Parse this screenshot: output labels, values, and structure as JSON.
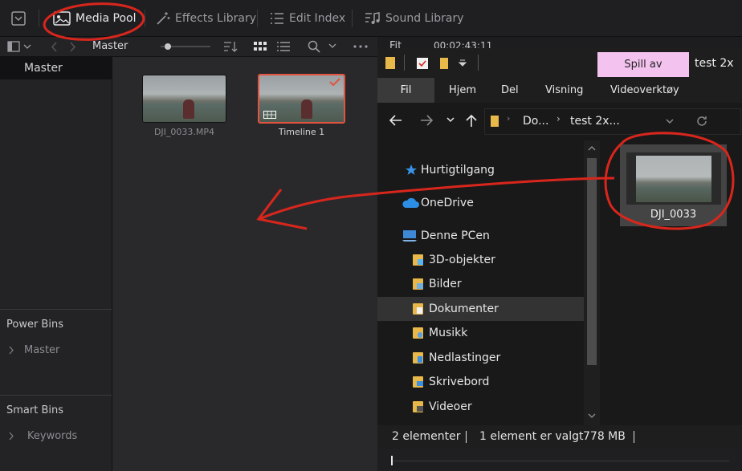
{
  "topbar": {
    "media_pool": "Media Pool",
    "effects_library": "Effects Library",
    "edit_index": "Edit Index",
    "sound_library": "Sound Library"
  },
  "toolbar2": {
    "bin_name": "Master",
    "fit_label": "Fit",
    "timecode": "00:02:43:11"
  },
  "sidebar": {
    "master": "Master",
    "power_bins": "Power Bins",
    "power_master": "Master",
    "smart_bins": "Smart Bins",
    "keywords": "Keywords"
  },
  "pool": {
    "clips": [
      {
        "name": "DJI_0033.MP4"
      },
      {
        "name": "Timeline 1"
      }
    ]
  },
  "explorer": {
    "play_button": "Spill av",
    "window_title": "test 2x",
    "ribbon_tabs": [
      "Fil",
      "Hjem",
      "Del",
      "Visning",
      "Videoverktøy"
    ],
    "breadcrumb_1": "Do...",
    "breadcrumb_2": "test 2x...",
    "tree": [
      "Hurtigtilgang",
      "OneDrive",
      "Denne PCen",
      "3D-objekter",
      "Bilder",
      "Dokumenter",
      "Musikk",
      "Nedlastinger",
      "Skrivebord",
      "Videoer"
    ],
    "file_name": "DJI_0033",
    "status_count": "2 elementer",
    "status_selected": "1 element er valgt",
    "status_size": "778 MB"
  },
  "colors": {
    "annotation_red": "#d9261c",
    "selected_clip_border": "#e2543f",
    "play_button_bg": "#f4c2ef"
  }
}
